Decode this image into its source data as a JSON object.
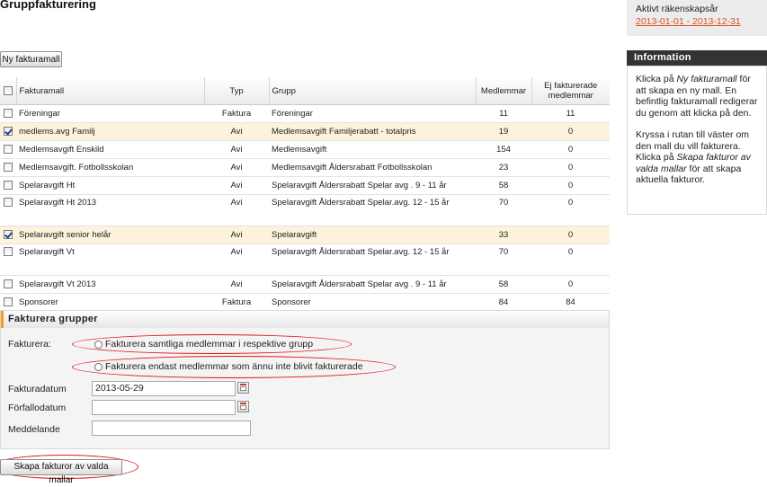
{
  "page": {
    "title": "Gruppfakturering",
    "new_template_button": "Ny fakturamall",
    "create_invoices_button": "Skapa fakturor av valda mallar"
  },
  "table": {
    "headers": {
      "template": "Fakturamall",
      "type": "Typ",
      "group": "Grupp",
      "members": "Medlemmar",
      "not_invoiced": "Ej fakturerade medlemmar"
    },
    "rows": [
      {
        "checked": false,
        "template": "Föreningar",
        "type": "Faktura",
        "group": "Föreningar",
        "members": "11",
        "not_invoiced": "11"
      },
      {
        "checked": true,
        "template": "medlems.avg Familj",
        "type": "Avi",
        "group": "Medlemsavgift Familjerabatt - totalpris",
        "members": "19",
        "not_invoiced": "0"
      },
      {
        "checked": false,
        "template": "Medlemsavgift Enskild",
        "type": "Avi",
        "group": "Medlemsavgift",
        "members": "154",
        "not_invoiced": "0"
      },
      {
        "checked": false,
        "template": "Medlemsavgift. Fotbollsskolan",
        "type": "Avi",
        "group": "Medlemsavgift Åldersrabatt Fotbollsskolan",
        "members": "23",
        "not_invoiced": "0"
      },
      {
        "checked": false,
        "template": "Spelaravgift Ht",
        "type": "Avi",
        "group": "Spelaravgift Åldersrabatt Spelar avg . 9 - 11 år",
        "members": "58",
        "not_invoiced": "0"
      },
      {
        "checked": false,
        "template": "Spelaravgift Ht 2013",
        "type": "Avi",
        "group": "Spelaravgift Åldersrabatt Spelar.avg. 12 - 15 år",
        "members": "70",
        "not_invoiced": "0"
      },
      {
        "checked": true,
        "template": "Spelaravgift senior helår",
        "type": "Avi",
        "group": "Spelaravgift",
        "members": "33",
        "not_invoiced": "0"
      },
      {
        "checked": false,
        "template": "Spelaravgift Vt",
        "type": "Avi",
        "group": "Spelaravgift Åldersrabatt Spelar.avg. 12 - 15 år",
        "members": "70",
        "not_invoiced": "0"
      },
      {
        "checked": false,
        "template": "Spelaravgift Vt 2013",
        "type": "Avi",
        "group": "Spelaravgift Åldersrabatt Spelar avg . 9 - 11 år",
        "members": "58",
        "not_invoiced": "0"
      },
      {
        "checked": false,
        "template": "Sponsorer",
        "type": "Faktura",
        "group": "Sponsorer",
        "members": "84",
        "not_invoiced": "84"
      }
    ]
  },
  "invoice_form": {
    "title": "Fakturera grupper",
    "fakturera_label": "Fakturera:",
    "option_all": "Fakturera samtliga medlemmar i respektive grupp",
    "option_not_invoiced": "Fakturera endast medlemmar som ännu inte blivit fakturerade",
    "invoice_date_label": "Fakturadatum",
    "invoice_date_value": "2013-05-29",
    "due_date_label": "Förfallodatum",
    "due_date_value": "",
    "message_label": "Meddelande",
    "message_value": ""
  },
  "sidebar": {
    "fiscal_year_label": "Aktivt räkenskapsår",
    "fiscal_year_link": "2013-01-01 - 2013-12-31",
    "info_title": "Information",
    "info_p1_pre": "Klicka på ",
    "info_p1_em": "Ny fakturamall",
    "info_p1_post": " för att skapa en ny mall. En befintlig fakturamall redigerar du genom att klicka på den.",
    "info_p2_pre": "Kryssa i rutan till väster om den mall du vill fakturera. Klicka på ",
    "info_p2_em": "Skapa fakturor av valda mallar",
    "info_p2_post": " för att skapa aktuella fakturor."
  },
  "colors": {
    "selected_row": "#fdf3dc",
    "link": "#d9531e",
    "annotation": "#e0141b",
    "panel_accent": "#f0a020"
  }
}
